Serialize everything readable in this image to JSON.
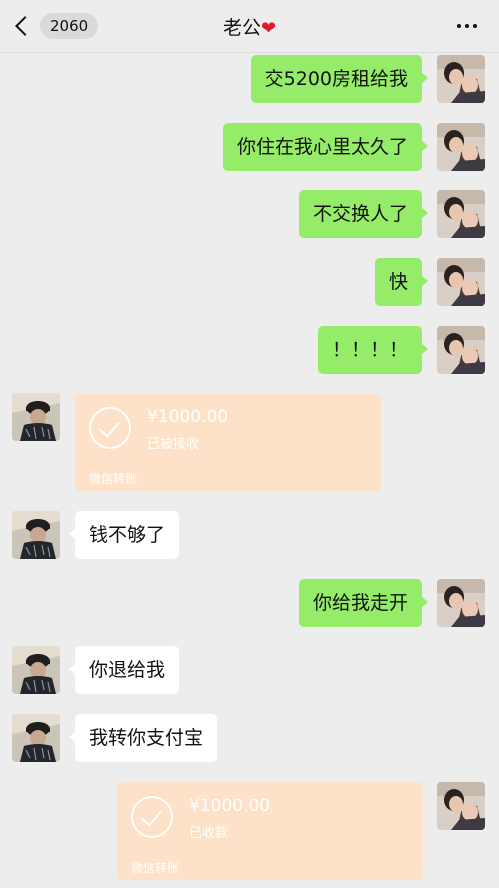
{
  "header": {
    "badge_count": "2060",
    "title": "老公",
    "heart": "❤"
  },
  "messages": [
    {
      "side": "me",
      "text": "交5200房租给我"
    },
    {
      "side": "me",
      "text": "你住在我心里太久了"
    },
    {
      "side": "me",
      "text": "不交换人了"
    },
    {
      "side": "me",
      "text": "快"
    },
    {
      "side": "me",
      "text": "！！！！"
    },
    {
      "side": "other",
      "type": "transfer",
      "amount": "¥1000.00",
      "status": "已被接收",
      "footer": "微信转账"
    },
    {
      "side": "other",
      "text": "钱不够了"
    },
    {
      "side": "me",
      "text": "你给我走开"
    },
    {
      "side": "other",
      "text": "你退给我"
    },
    {
      "side": "other",
      "text": "我转你支付宝"
    },
    {
      "side": "me",
      "type": "transfer",
      "amount": "¥1000.00",
      "status": "已收款",
      "footer": "微信转账"
    }
  ],
  "colors": {
    "my_bubble": "#95ec69",
    "their_bubble": "#ffffff",
    "transfer_card": "#fde1c8",
    "background": "#ededed"
  }
}
